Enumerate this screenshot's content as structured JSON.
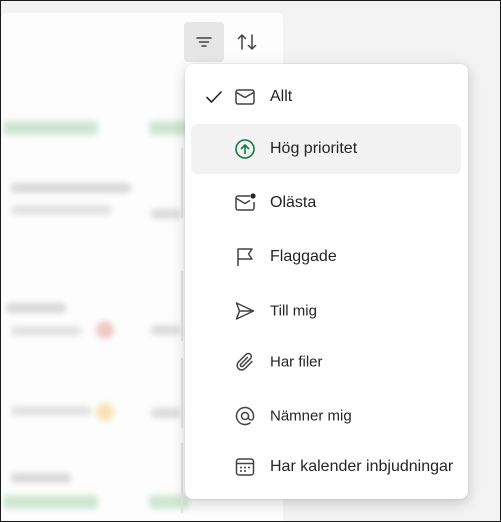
{
  "menu": {
    "items": [
      {
        "label": "Allt",
        "icon": "envelope-icon",
        "checked": true
      },
      {
        "label": "Hög prioritet",
        "icon": "arrow-up-circle-icon",
        "hovered": true
      },
      {
        "label": "Olästa",
        "icon": "envelope-unread-icon"
      },
      {
        "label": "Flaggade",
        "icon": "flag-icon"
      },
      {
        "label": "Till mig",
        "icon": "send-icon"
      },
      {
        "label": "Har filer",
        "icon": "paperclip-icon"
      },
      {
        "label": "Nämner mig",
        "icon": "at-sign-icon"
      },
      {
        "label": "Har kalender inbjudningar",
        "icon": "calendar-icon"
      }
    ]
  },
  "toolbar": {
    "filter_icon": "filter-icon",
    "sort_icon": "sort-icon"
  },
  "colors": {
    "priority_green": "#107c41",
    "text": "#242424",
    "hover_bg": "#f2f2f2"
  }
}
